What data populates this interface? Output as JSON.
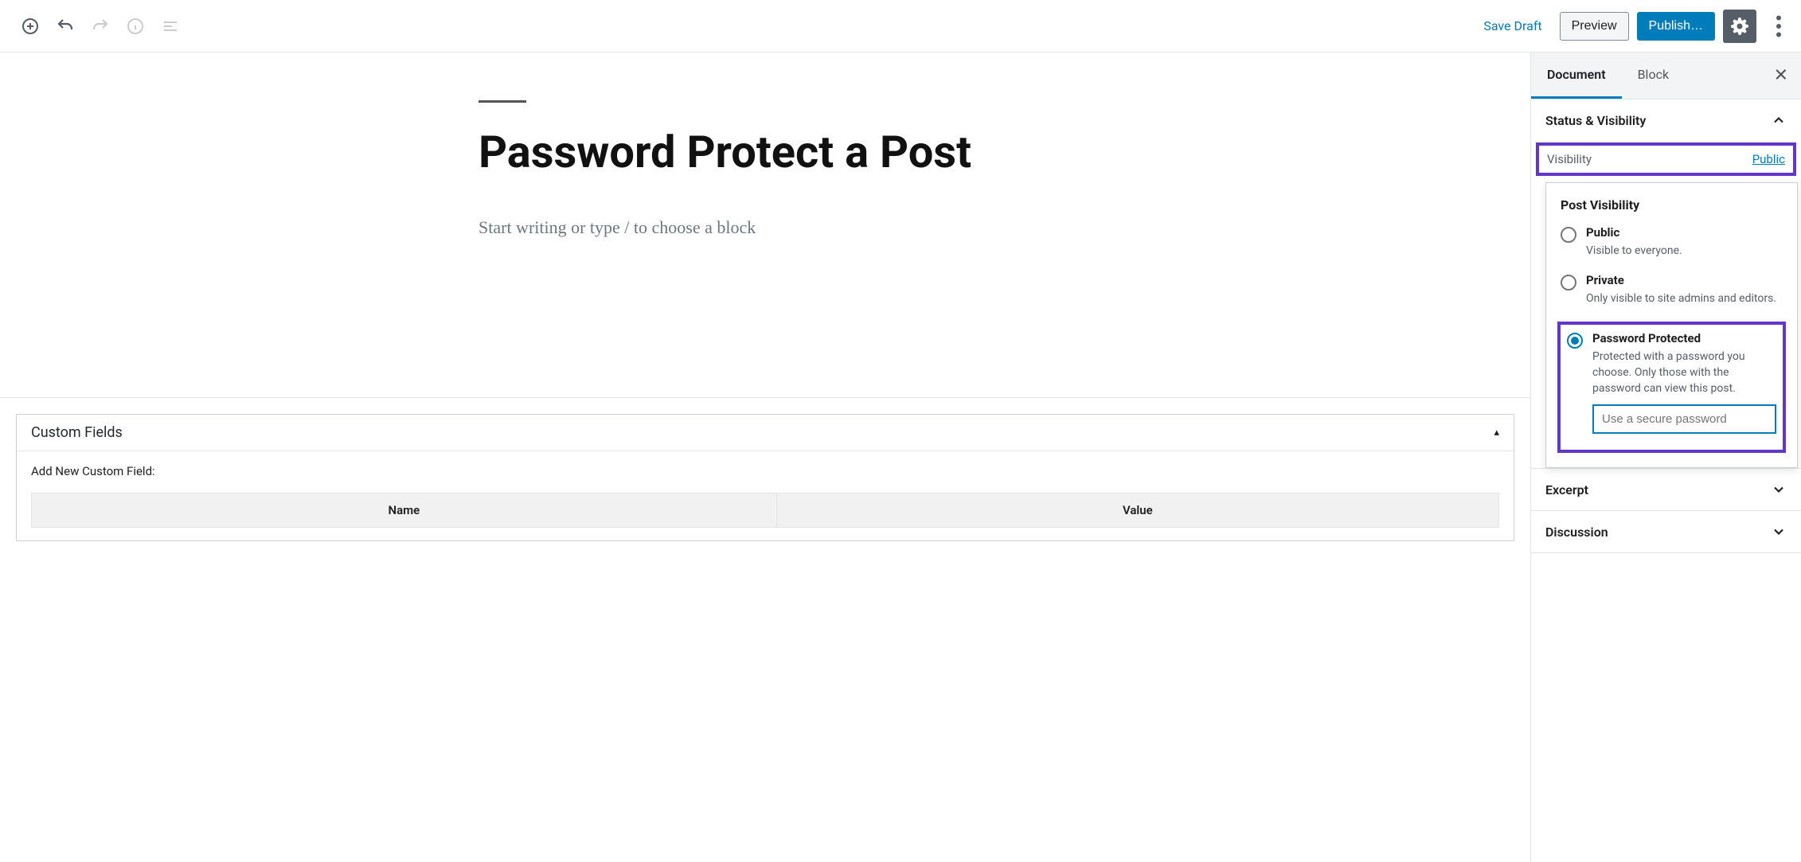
{
  "toolbar": {
    "save_draft": "Save Draft",
    "preview": "Preview",
    "publish": "Publish…"
  },
  "editor": {
    "post_title": "Password Protect a Post",
    "block_placeholder": "Start writing or type / to choose a block"
  },
  "custom_fields": {
    "title": "Custom Fields",
    "add_new_label": "Add New Custom Field:",
    "columns": {
      "name": "Name",
      "value": "Value"
    }
  },
  "sidebar": {
    "tabs": {
      "document": "Document",
      "block": "Block"
    },
    "status_visibility": {
      "title": "Status & Visibility",
      "visibility_label": "Visibility",
      "visibility_value": "Public"
    },
    "post_visibility": {
      "title": "Post Visibility",
      "options": {
        "public": {
          "label": "Public",
          "desc": "Visible to everyone."
        },
        "private": {
          "label": "Private",
          "desc": "Only visible to site admins and editors."
        },
        "password": {
          "label": "Password Protected",
          "desc": "Protected with a password you choose. Only those with the password can view this post.",
          "placeholder": "Use a secure password"
        }
      }
    },
    "excerpt": "Excerpt",
    "discussion": "Discussion"
  }
}
